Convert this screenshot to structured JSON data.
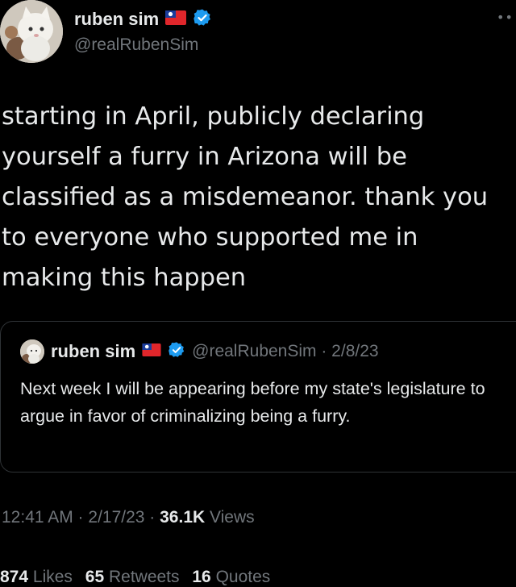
{
  "author": {
    "display_name": "ruben sim",
    "handle": "@realRubenSim",
    "flag_icon": "taiwan-flag-icon",
    "verified_icon": "verified-badge-icon",
    "verified_color": "#1d9bf0"
  },
  "tweet": {
    "lines": [
      "starting in April, publicly declaring",
      "yourself a furry in Arizona will be",
      "classified as a misdemeanor. thank you",
      "to everyone who supported me in",
      "making this happen"
    ]
  },
  "quote": {
    "display_name": "ruben sim",
    "handle_date": "@realRubenSim · 2/8/23",
    "text": "Next week I will be appearing before my state's legislature to argue in favor of criminalizing being a furry."
  },
  "meta": {
    "time_date": "12:41 AM · 2/17/23 · ",
    "views_count": "36.1K",
    "views_label": " Views"
  },
  "stats": {
    "likes_count": "874",
    "likes_label": "Likes",
    "retweets_count": "65",
    "retweets_label": "Retweets",
    "quotes_count": "16",
    "quotes_label": "Quotes"
  },
  "more_icon": "more-options-icon"
}
